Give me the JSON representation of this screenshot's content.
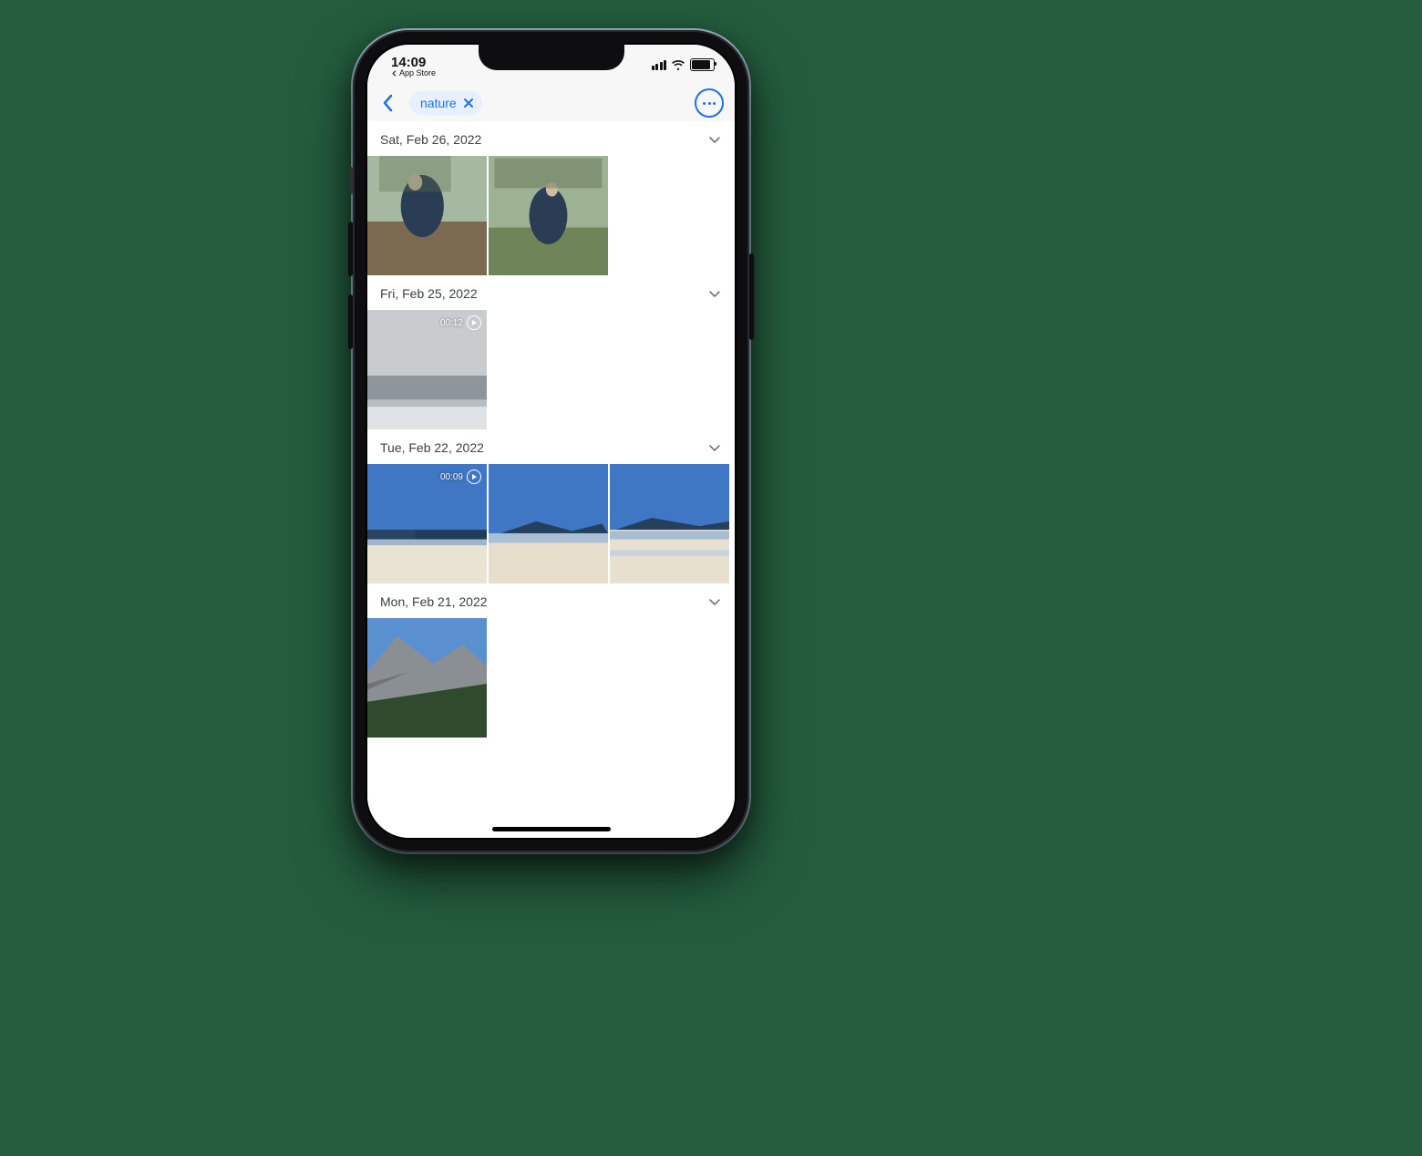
{
  "statusbar": {
    "time": "14:09",
    "breadcrumb_label": "App Store"
  },
  "nav": {
    "search_chip": "nature"
  },
  "sections": [
    {
      "date_label": "Sat, Feb 26, 2022",
      "items": [
        {
          "kind": "photo"
        },
        {
          "kind": "photo"
        }
      ]
    },
    {
      "date_label": "Fri, Feb 25, 2022",
      "items": [
        {
          "kind": "video",
          "duration": "00:12"
        }
      ]
    },
    {
      "date_label": "Tue, Feb 22, 2022",
      "items": [
        {
          "kind": "video",
          "duration": "00:09"
        },
        {
          "kind": "photo"
        },
        {
          "kind": "photo"
        }
      ]
    },
    {
      "date_label": "Mon, Feb 21, 2022",
      "items": [
        {
          "kind": "photo"
        }
      ]
    }
  ]
}
